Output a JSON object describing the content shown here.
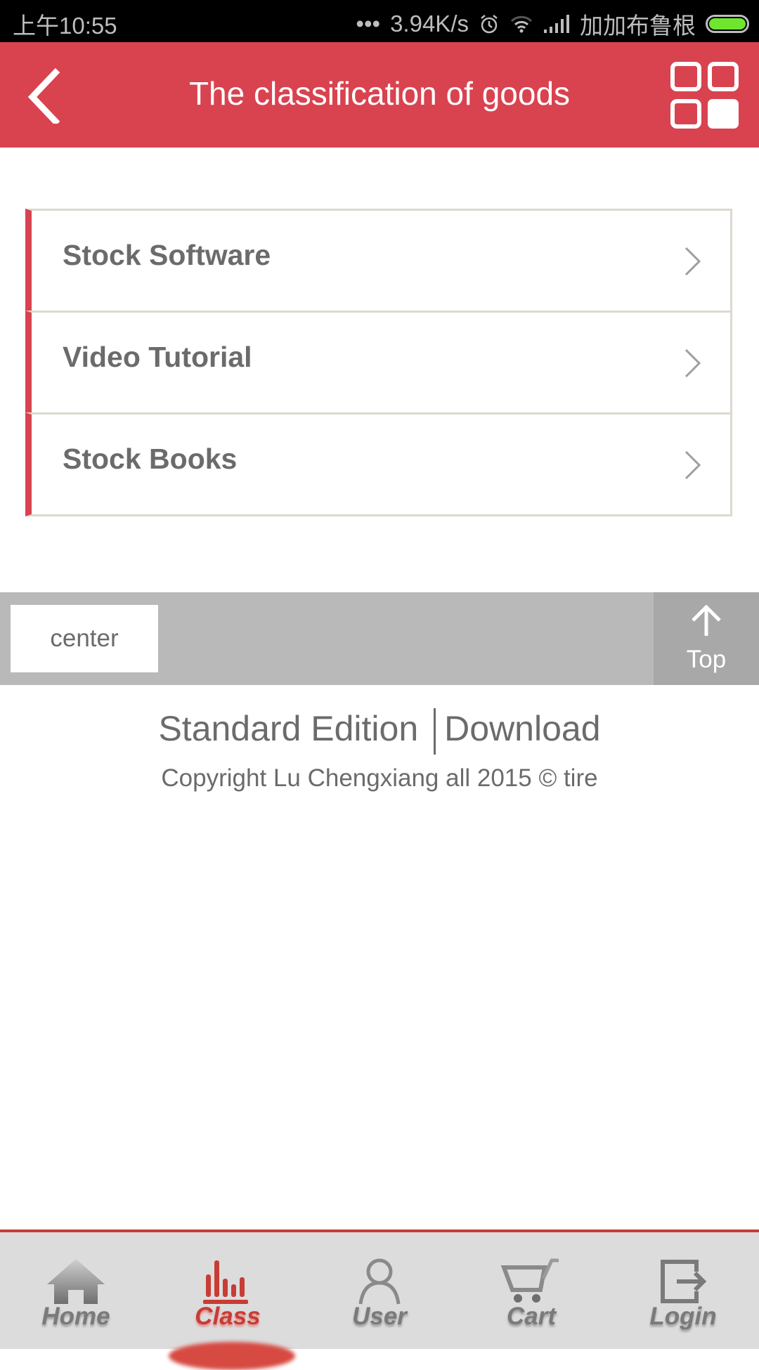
{
  "status_bar": {
    "time": "上午10:55",
    "network_speed": "3.94K/s",
    "carrier": "加加布鲁根",
    "icons": [
      "more-dots-icon",
      "alarm-icon",
      "wifi-icon",
      "signal-icon",
      "battery-icon"
    ],
    "battery_color": "#6ee62d"
  },
  "header": {
    "title": "The classification of goods",
    "back_icon": "chevron-left-icon",
    "menu_icon": "grid-icon",
    "bg_color": "#d8434f"
  },
  "categories": [
    {
      "label": "Stock Software"
    },
    {
      "label": "Video Tutorial"
    },
    {
      "label": "Stock Books"
    }
  ],
  "footer_bar": {
    "center_label": "center",
    "top_label": "Top"
  },
  "footer": {
    "standard_edition": "Standard Edition",
    "download": "Download",
    "copyright": "Copyright Lu Chengxiang all 2015 © tire"
  },
  "tabbar": {
    "active": "Class",
    "accent_color": "#c83c36",
    "tabs": [
      {
        "label": "Home",
        "icon": "home-icon"
      },
      {
        "label": "Class",
        "icon": "bar-chart-icon"
      },
      {
        "label": "User",
        "icon": "user-icon"
      },
      {
        "label": "Cart",
        "icon": "cart-icon"
      },
      {
        "label": "Login",
        "icon": "login-icon"
      }
    ]
  }
}
